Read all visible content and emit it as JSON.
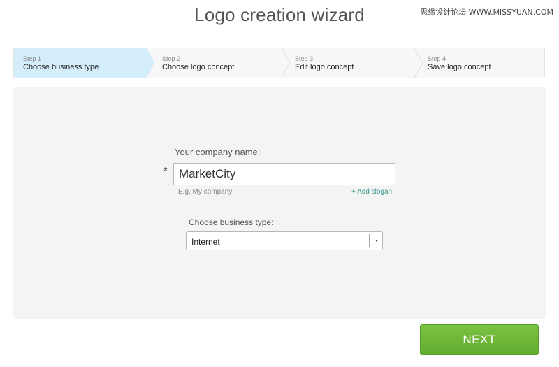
{
  "watermark": "思缘设计论坛 WWW.MISSYUAN.COM",
  "title": "Logo creation wizard",
  "steps": [
    {
      "num": "Step 1",
      "label": "Choose business type",
      "active": true
    },
    {
      "num": "Step 2",
      "label": "Choose logo concept",
      "active": false
    },
    {
      "num": "Step 3",
      "label": "Edit logo concept",
      "active": false
    },
    {
      "num": "Step 4",
      "label": "Save logo concept",
      "active": false
    }
  ],
  "form": {
    "company_label": "Your company name:",
    "required_mark": "*",
    "company_value": "MarketCity",
    "company_hint": "E.g. My company",
    "add_slogan": "+ Add slogan",
    "business_label": "Choose business type:",
    "business_value": "Internet"
  },
  "next_label": "NEXT",
  "colors": {
    "active_step": "#d5eefb",
    "next_button": "#6ab436",
    "link": "#3a9a8c"
  }
}
